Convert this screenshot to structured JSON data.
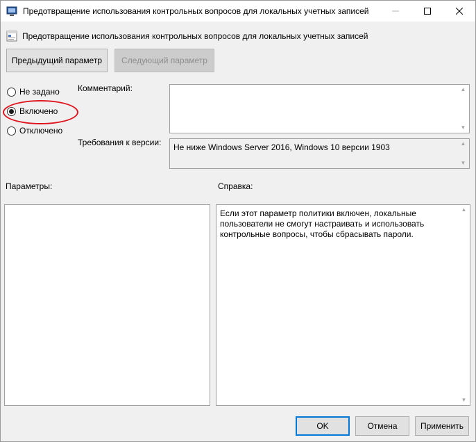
{
  "window": {
    "title": "Предотвращение использования контрольных вопросов для локальных учетных записей",
    "controls": {
      "minimize": "—",
      "maximize": "☐",
      "close": "✕"
    }
  },
  "header": {
    "policy_name": "Предотвращение использования контрольных вопросов для локальных учетных записей"
  },
  "nav": {
    "previous_label": "Предыдущий параметр",
    "next_label": "Следующий параметр"
  },
  "state": {
    "options": [
      {
        "label": "Не задано",
        "checked": false
      },
      {
        "label": "Включено",
        "checked": true
      },
      {
        "label": "Отключено",
        "checked": false
      }
    ]
  },
  "comment": {
    "label": "Комментарий:",
    "value": ""
  },
  "supported": {
    "label": "Требования к версии:",
    "value": "Не ниже Windows Server 2016, Windows 10 версии 1903"
  },
  "options_pane": {
    "label": "Параметры:"
  },
  "help_pane": {
    "label": "Справка:",
    "text": "Если этот параметр политики включен, локальные пользователи не смогут настраивать и использовать контрольные вопросы, чтобы сбрасывать пароли."
  },
  "footer": {
    "ok_label": "OK",
    "cancel_label": "Отмена",
    "apply_label": "Применить"
  },
  "colors": {
    "accent": "#0078d7",
    "highlight": "#e0141e"
  }
}
